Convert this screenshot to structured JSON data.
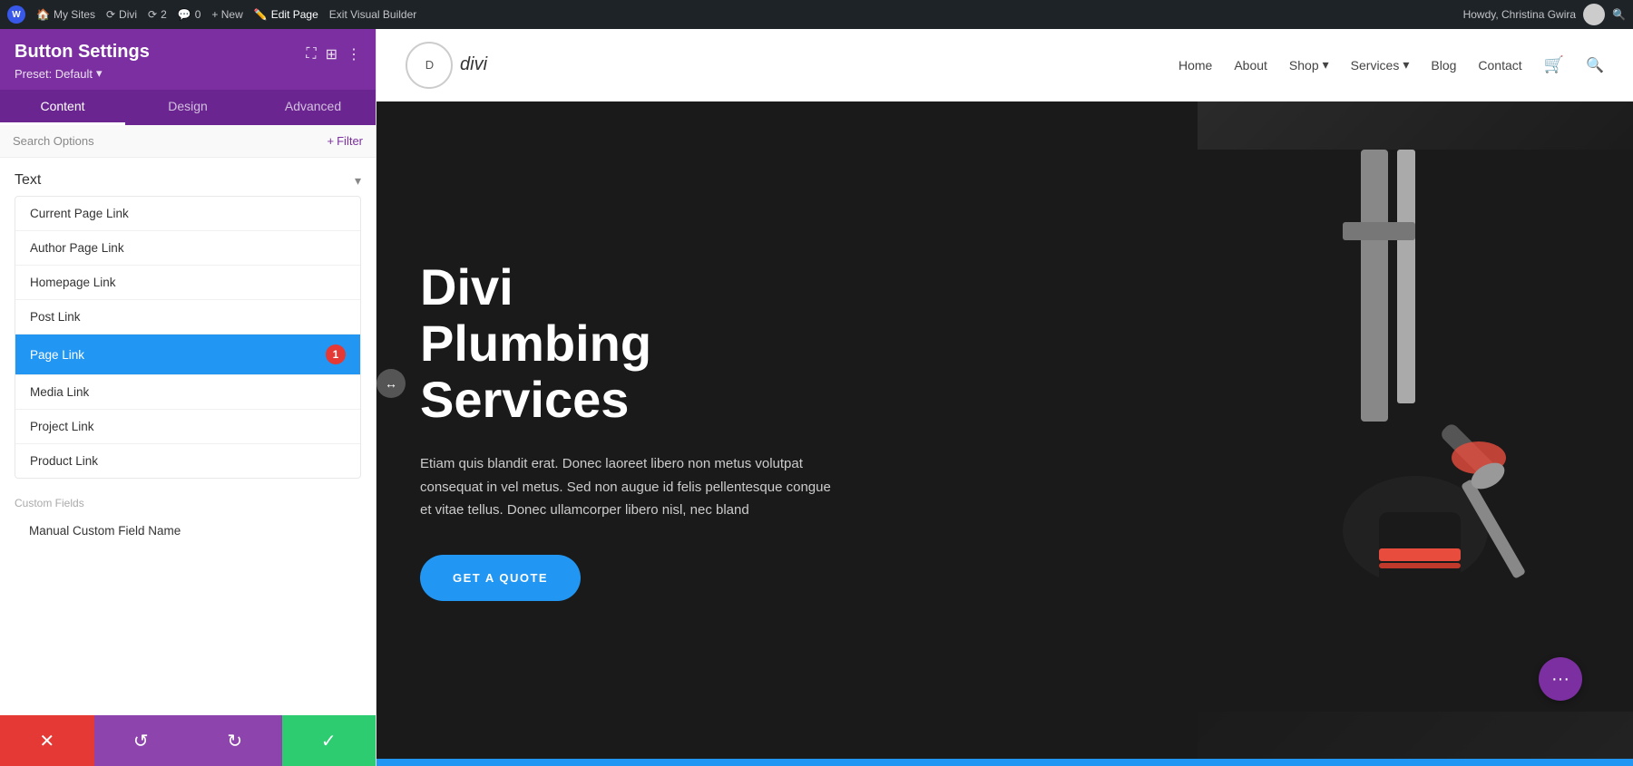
{
  "adminBar": {
    "wpLabel": "W",
    "mySites": "My Sites",
    "siteName": "Divi",
    "updates": "2",
    "comments": "0",
    "newLabel": "+ New",
    "editPage": "Edit Page",
    "exitBuilder": "Exit Visual Builder",
    "userGreeting": "Howdy, Christina Gwira",
    "searchIcon": "🔍"
  },
  "panel": {
    "title": "Button Settings",
    "preset": "Preset: Default",
    "tabs": [
      "Content",
      "Design",
      "Advanced"
    ],
    "activeTab": 0,
    "searchPlaceholder": "Search Options",
    "filterLabel": "+ Filter"
  },
  "textSection": {
    "label": "Text",
    "chevron": "▾",
    "linkOptions": [
      {
        "label": "Current Page Link",
        "active": false
      },
      {
        "label": "Author Page Link",
        "active": false
      },
      {
        "label": "Homepage Link",
        "active": false
      },
      {
        "label": "Post Link",
        "active": false
      },
      {
        "label": "Page Link",
        "active": true,
        "badge": "1"
      },
      {
        "label": "Media Link",
        "active": false
      },
      {
        "label": "Project Link",
        "active": false
      },
      {
        "label": "Product Link",
        "active": false
      }
    ]
  },
  "customFields": {
    "label": "Custom Fields",
    "items": [
      {
        "label": "Manual Custom Field Name"
      }
    ]
  },
  "actions": {
    "cancel": "✕",
    "undo": "↺",
    "redo": "↻",
    "confirm": "✓"
  },
  "siteNav": {
    "logoCircle": "D divi",
    "logoInner": "divi",
    "items": [
      {
        "label": "Home"
      },
      {
        "label": "About"
      },
      {
        "label": "Shop",
        "hasDropdown": true
      },
      {
        "label": "Services",
        "hasDropdown": true
      },
      {
        "label": "Blog"
      },
      {
        "label": "Contact"
      }
    ],
    "cartIcon": "🛒",
    "searchIcon": "🔍"
  },
  "hero": {
    "title": "Divi Plumbing Services",
    "body": "Etiam quis blandit erat. Donec laoreet libero non metus volutpat consequat in vel metus. Sed non augue id felis pellentesque congue et vitae tellus. Donec ullamcorper libero nisl, nec bland",
    "cta": "GET A QUOTE"
  },
  "fab": {
    "icon": "•••"
  }
}
